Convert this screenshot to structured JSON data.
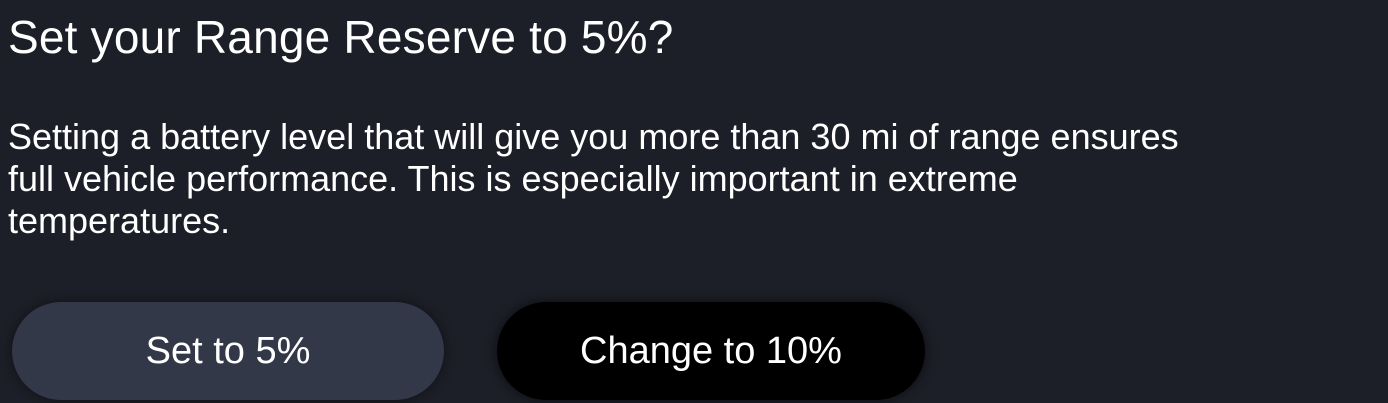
{
  "dialog": {
    "title": "Set your Range Reserve to 5%?",
    "body_lines": [
      "Setting a battery level that will give you more than 30 mi of range ensures",
      "full vehicle performance. This is especially important in extreme",
      "temperatures."
    ],
    "buttons": {
      "secondary_label": "Set to 5%",
      "primary_label": "Change to 10%"
    }
  },
  "colors": {
    "background": "#1d1f28",
    "secondary_button": "#333849",
    "primary_button": "#000000",
    "text": "#ffffff"
  }
}
